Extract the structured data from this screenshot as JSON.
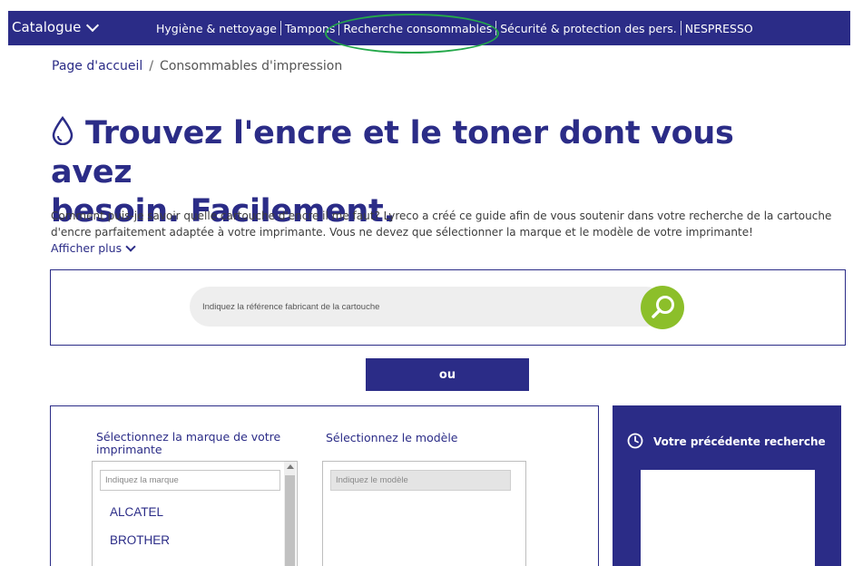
{
  "nav": {
    "catalogue_label": "Catalogue",
    "items": [
      "Hygiène & nettoyage",
      "Tampons",
      "Recherche consommables",
      "Sécurité & protection des pers.",
      "NESPRESSO"
    ],
    "highlighted_item": "Recherche consommables",
    "highlight_color": "#24a84a",
    "background_color": "#2b2c87"
  },
  "breadcrumb": {
    "home": "Page d'accueil",
    "separator": "/",
    "current": "Consommables d'impression"
  },
  "page": {
    "title_line1": "Trouvez l'encre et le toner dont vous avez",
    "title_line2": "besoin. Facilement.",
    "intro_line1": "Comment puis-je savoir quelle cartouche d'encre il me faut? Lyreco a créé ce guide afin de vous soutenir dans votre recherche de la cartouche",
    "intro_line2": "d'encre parfaitement adaptée à votre imprimante. Vous ne devez que sélectionner la marque et le modèle de votre imprimante!",
    "show_more": "Afficher plus"
  },
  "search": {
    "placeholder": "Indiquez la référence fabricant de la cartouche",
    "button_color": "#8cbf2a"
  },
  "or_button": "ou",
  "selector": {
    "brand_label": "Sélectionnez la marque de votre imprimante",
    "brand_placeholder": "Indiquez la marque",
    "brands": [
      "ALCATEL",
      "BROTHER"
    ],
    "model_label": "Sélectionnez le modèle",
    "model_placeholder": "Indiquez le modèle"
  },
  "previous": {
    "title": "Votre précédente recherche"
  },
  "colors": {
    "primary": "#2b2c87",
    "accent_green": "#8cbf2a"
  }
}
